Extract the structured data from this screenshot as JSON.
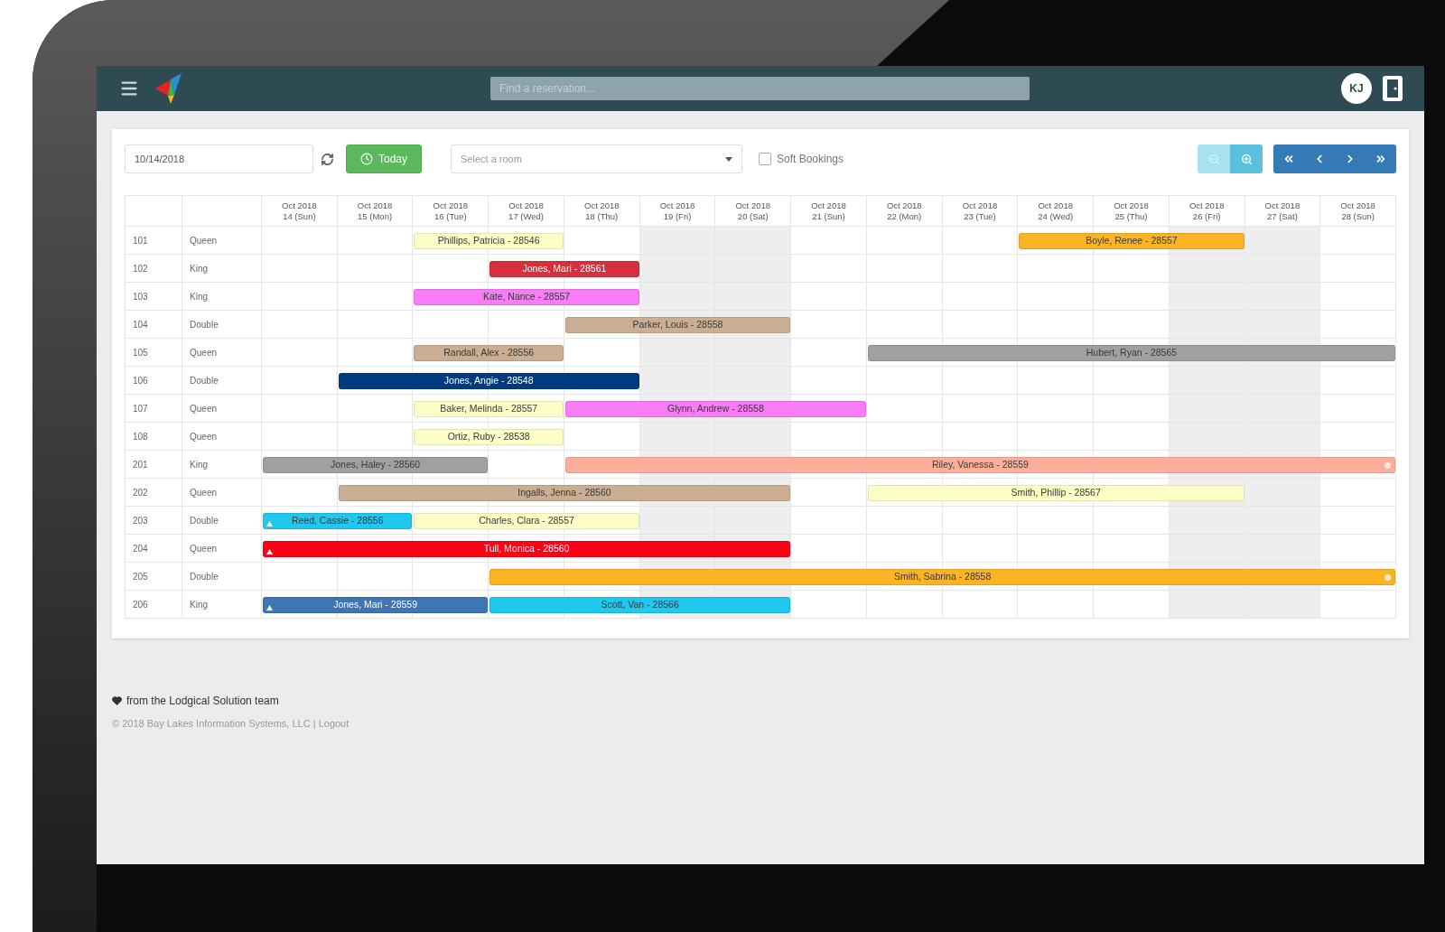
{
  "navbar": {
    "search": {
      "placeholder": "Find a reservation..."
    },
    "user": {
      "initials": "KJ"
    }
  },
  "toolbar": {
    "date": {
      "value": "10/14/2018"
    },
    "today_button": "Today",
    "room_select": {
      "placeholder": "Select a room"
    },
    "soft_bookings": {
      "label": "Soft Bookings",
      "checked": false
    },
    "zoom_buttons": [
      {
        "kind": "zoom_out",
        "disabled": true
      },
      {
        "kind": "zoom_in",
        "disabled": false
      }
    ]
  },
  "calendar": {
    "columns": [
      {
        "month": "Oct 2018",
        "day": "14 (Sun)",
        "shaded": false
      },
      {
        "month": "Oct 2018",
        "day": "15 (Mon)",
        "shaded": false
      },
      {
        "month": "Oct 2018",
        "day": "16 (Tue)",
        "shaded": false
      },
      {
        "month": "Oct 2018",
        "day": "17 (Wed)",
        "shaded": false
      },
      {
        "month": "Oct 2018",
        "day": "18 (Thu)",
        "shaded": false
      },
      {
        "month": "Oct 2018",
        "day": "19 (Fri)",
        "shaded": true
      },
      {
        "month": "Oct 2018",
        "day": "20 (Sat)",
        "shaded": true
      },
      {
        "month": "Oct 2018",
        "day": "21 (Sun)",
        "shaded": false
      },
      {
        "month": "Oct 2018",
        "day": "22 (Mon)",
        "shaded": false
      },
      {
        "month": "Oct 2018",
        "day": "23 (Tue)",
        "shaded": false
      },
      {
        "month": "Oct 2018",
        "day": "24 (Wed)",
        "shaded": false
      },
      {
        "month": "Oct 2018",
        "day": "25 (Thu)",
        "shaded": false
      },
      {
        "month": "Oct 2018",
        "day": "26 (Fri)",
        "shaded": true
      },
      {
        "month": "Oct 2018",
        "day": "27 (Sat)",
        "shaded": true
      },
      {
        "month": "Oct 2018",
        "day": "28 (Sun)",
        "shaded": false
      }
    ],
    "rows": [
      {
        "room": "101",
        "type": "Queen",
        "days": [
          {
            "kind": "vacant"
          },
          {
            "kind": "vacant"
          },
          {
            "kind": "check_in",
            "label": "Phillips, Patricia - 28546",
            "color": "#fdfdc6",
            "marker_start": false,
            "marker_end": false
          },
          {
            "kind": "stay"
          },
          {
            "kind": "vacant"
          },
          {
            "kind": "vacant"
          },
          {
            "kind": "vacant"
          },
          {
            "kind": "vacant"
          },
          {
            "kind": "vacant"
          },
          {
            "kind": "vacant"
          },
          {
            "kind": "check_in",
            "label": "Boyle, Renee - 28557",
            "color": "#fbb424",
            "marker_start": false,
            "marker_end": false
          },
          {
            "kind": "stay"
          },
          {
            "kind": "stay"
          },
          {
            "kind": "vacant"
          },
          {
            "kind": "vacant"
          }
        ]
      },
      {
        "room": "102",
        "type": "King",
        "days": [
          {
            "kind": "vacant"
          },
          {
            "kind": "vacant"
          },
          {
            "kind": "vacant"
          },
          {
            "kind": "check_in",
            "label": "Jones, Mari - 28561",
            "color": "#d7303c",
            "marker_start": false,
            "marker_end": false
          },
          {
            "kind": "stay"
          },
          {
            "kind": "vacant"
          },
          {
            "kind": "vacant"
          },
          {
            "kind": "vacant"
          },
          {
            "kind": "vacant"
          },
          {
            "kind": "vacant"
          },
          {
            "kind": "vacant"
          },
          {
            "kind": "vacant"
          },
          {
            "kind": "vacant"
          },
          {
            "kind": "vacant"
          },
          {
            "kind": "vacant"
          }
        ]
      },
      {
        "room": "103",
        "type": "King",
        "days": [
          {
            "kind": "vacant"
          },
          {
            "kind": "vacant"
          },
          {
            "kind": "check_in",
            "label": "Kate, Nance - 28557",
            "color": "#f77cf5",
            "marker_start": false,
            "marker_end": false
          },
          {
            "kind": "stay"
          },
          {
            "kind": "stay"
          },
          {
            "kind": "vacant"
          },
          {
            "kind": "vacant"
          },
          {
            "kind": "vacant"
          },
          {
            "kind": "vacant"
          },
          {
            "kind": "vacant"
          },
          {
            "kind": "vacant"
          },
          {
            "kind": "vacant"
          },
          {
            "kind": "vacant"
          },
          {
            "kind": "vacant"
          },
          {
            "kind": "vacant"
          }
        ]
      },
      {
        "room": "104",
        "type": "Double",
        "days": [
          {
            "kind": "vacant"
          },
          {
            "kind": "vacant"
          },
          {
            "kind": "vacant"
          },
          {
            "kind": "vacant"
          },
          {
            "kind": "check_in",
            "label": "Parker, Louis - 28558",
            "color": "#c9ae93",
            "marker_start": false,
            "marker_end": false
          },
          {
            "kind": "stay"
          },
          {
            "kind": "stay"
          },
          {
            "kind": "vacant"
          },
          {
            "kind": "vacant"
          },
          {
            "kind": "vacant"
          },
          {
            "kind": "vacant"
          },
          {
            "kind": "vacant"
          },
          {
            "kind": "vacant"
          },
          {
            "kind": "vacant"
          },
          {
            "kind": "vacant"
          }
        ]
      },
      {
        "room": "105",
        "type": "Queen",
        "days": [
          {
            "kind": "vacant"
          },
          {
            "kind": "vacant"
          },
          {
            "kind": "check_in",
            "label": "Randall, Alex - 28556",
            "color": "#c9ae93",
            "marker_start": false,
            "marker_end": false
          },
          {
            "kind": "stay"
          },
          {
            "kind": "vacant"
          },
          {
            "kind": "vacant"
          },
          {
            "kind": "vacant"
          },
          {
            "kind": "vacant"
          },
          {
            "kind": "check_in",
            "label": "Hubert, Ryan - 28565",
            "color": "#9fa0a2",
            "marker_start": false,
            "marker_end": false
          },
          {
            "kind": "stay"
          },
          {
            "kind": "stay"
          },
          {
            "kind": "stay"
          },
          {
            "kind": "stay"
          },
          {
            "kind": "stay"
          },
          {
            "kind": "stay"
          }
        ]
      },
      {
        "room": "106",
        "type": "Double",
        "days": [
          {
            "kind": "vacant"
          },
          {
            "kind": "check_in",
            "label": "Jones, Angie - 28548",
            "color": "#003b7f",
            "marker_start": false,
            "marker_end": false
          },
          {
            "kind": "stay"
          },
          {
            "kind": "stay"
          },
          {
            "kind": "stay"
          },
          {
            "kind": "vacant"
          },
          {
            "kind": "vacant"
          },
          {
            "kind": "vacant"
          },
          {
            "kind": "vacant"
          },
          {
            "kind": "vacant"
          },
          {
            "kind": "vacant"
          },
          {
            "kind": "vacant"
          },
          {
            "kind": "vacant"
          },
          {
            "kind": "vacant"
          },
          {
            "kind": "vacant"
          }
        ]
      },
      {
        "room": "107",
        "type": "Queen",
        "days": [
          {
            "kind": "vacant"
          },
          {
            "kind": "vacant"
          },
          {
            "kind": "check_in",
            "label": "Baker, Melinda - 28557",
            "color": "#fdfdc6",
            "marker_start": false,
            "marker_end": false
          },
          {
            "kind": "stay"
          },
          {
            "kind": "check_in",
            "label": "Glynn, Andrew - 28558",
            "color": "#f77cf5",
            "marker_start": false,
            "marker_end": false
          },
          {
            "kind": "stay"
          },
          {
            "kind": "stay"
          },
          {
            "kind": "stay"
          },
          {
            "kind": "vacant"
          },
          {
            "kind": "vacant"
          },
          {
            "kind": "vacant"
          },
          {
            "kind": "vacant"
          },
          {
            "kind": "vacant"
          },
          {
            "kind": "vacant"
          },
          {
            "kind": "vacant"
          }
        ]
      },
      {
        "room": "108",
        "type": "Queen",
        "days": [
          {
            "kind": "vacant"
          },
          {
            "kind": "vacant"
          },
          {
            "kind": "check_in",
            "label": "Ortiz, Ruby - 28538",
            "color": "#fdfdc6",
            "marker_start": false,
            "marker_end": false
          },
          {
            "kind": "stay"
          },
          {
            "kind": "vacant"
          },
          {
            "kind": "vacant"
          },
          {
            "kind": "vacant"
          },
          {
            "kind": "vacant"
          },
          {
            "kind": "vacant"
          },
          {
            "kind": "vacant"
          },
          {
            "kind": "vacant"
          },
          {
            "kind": "vacant"
          },
          {
            "kind": "vacant"
          },
          {
            "kind": "vacant"
          },
          {
            "kind": "vacant"
          }
        ]
      },
      {
        "room": "201",
        "type": "King",
        "days": [
          {
            "kind": "check_in",
            "label": "Jones, Haley - 28560",
            "color": "#9fa0a2",
            "marker_start": false,
            "marker_end": false
          },
          {
            "kind": "stay"
          },
          {
            "kind": "stay"
          },
          {
            "kind": "vacant"
          },
          {
            "kind": "check_in",
            "label": "Riley, Vanessa - 28559",
            "color": "#fcae9b",
            "marker_start": false,
            "marker_end": true
          },
          {
            "kind": "stay"
          },
          {
            "kind": "stay"
          },
          {
            "kind": "stay"
          },
          {
            "kind": "stay"
          },
          {
            "kind": "stay"
          },
          {
            "kind": "stay"
          },
          {
            "kind": "stay"
          },
          {
            "kind": "stay"
          },
          {
            "kind": "stay"
          },
          {
            "kind": "stay"
          }
        ]
      },
      {
        "room": "202",
        "type": "Queen",
        "days": [
          {
            "kind": "vacant"
          },
          {
            "kind": "check_in",
            "label": "Ingalls, Jenna - 28560",
            "color": "#c9ae93",
            "marker_start": false,
            "marker_end": false
          },
          {
            "kind": "stay"
          },
          {
            "kind": "stay"
          },
          {
            "kind": "stay"
          },
          {
            "kind": "stay"
          },
          {
            "kind": "stay"
          },
          {
            "kind": "vacant"
          },
          {
            "kind": "check_in",
            "label": "Smith, Phillip - 28567",
            "color": "#fdfdc6",
            "marker_start": false,
            "marker_end": false
          },
          {
            "kind": "stay"
          },
          {
            "kind": "stay"
          },
          {
            "kind": "stay"
          },
          {
            "kind": "stay"
          },
          {
            "kind": "vacant"
          },
          {
            "kind": "vacant"
          }
        ]
      },
      {
        "room": "203",
        "type": "Double",
        "days": [
          {
            "kind": "check_in",
            "label": "Reed, Cassie - 28556",
            "color": "#1ec8ef",
            "marker_start": true,
            "marker_end": false
          },
          {
            "kind": "stay"
          },
          {
            "kind": "check_in",
            "label": "Charles, Clara - 28557",
            "color": "#fdfdc6",
            "marker_start": false,
            "marker_end": false
          },
          {
            "kind": "stay"
          },
          {
            "kind": "stay"
          },
          {
            "kind": "vacant"
          },
          {
            "kind": "vacant"
          },
          {
            "kind": "vacant"
          },
          {
            "kind": "vacant"
          },
          {
            "kind": "vacant"
          },
          {
            "kind": "vacant"
          },
          {
            "kind": "vacant"
          },
          {
            "kind": "vacant"
          },
          {
            "kind": "vacant"
          },
          {
            "kind": "vacant"
          }
        ]
      },
      {
        "room": "204",
        "type": "Queen",
        "days": [
          {
            "kind": "check_in",
            "label": "Tull, Monica - 28560",
            "color": "#ff0016",
            "marker_start": true,
            "marker_end": false
          },
          {
            "kind": "stay"
          },
          {
            "kind": "stay"
          },
          {
            "kind": "stay"
          },
          {
            "kind": "stay"
          },
          {
            "kind": "stay"
          },
          {
            "kind": "stay"
          },
          {
            "kind": "vacant"
          },
          {
            "kind": "vacant"
          },
          {
            "kind": "vacant"
          },
          {
            "kind": "vacant"
          },
          {
            "kind": "vacant"
          },
          {
            "kind": "vacant"
          },
          {
            "kind": "vacant"
          },
          {
            "kind": "vacant"
          }
        ]
      },
      {
        "room": "205",
        "type": "Double",
        "days": [
          {
            "kind": "vacant"
          },
          {
            "kind": "vacant"
          },
          {
            "kind": "vacant"
          },
          {
            "kind": "check_in",
            "label": "Smith, Sabrina - 28558",
            "color": "#fbb424",
            "marker_start": false,
            "marker_end": true
          },
          {
            "kind": "stay"
          },
          {
            "kind": "stay"
          },
          {
            "kind": "stay"
          },
          {
            "kind": "stay"
          },
          {
            "kind": "stay"
          },
          {
            "kind": "stay"
          },
          {
            "kind": "stay"
          },
          {
            "kind": "stay"
          },
          {
            "kind": "stay"
          },
          {
            "kind": "stay"
          },
          {
            "kind": "stay"
          }
        ]
      },
      {
        "room": "206",
        "type": "King",
        "days": [
          {
            "kind": "check_in",
            "label": "Jones, Mari - 28559",
            "color": "#3f74b5",
            "marker_start": true,
            "marker_end": false
          },
          {
            "kind": "stay"
          },
          {
            "kind": "stay"
          },
          {
            "kind": "check_in",
            "label": "Scott, Van - 28566",
            "color": "#1ec8ef",
            "marker_start": false,
            "marker_end": false
          },
          {
            "kind": "stay"
          },
          {
            "kind": "stay"
          },
          {
            "kind": "stay"
          },
          {
            "kind": "vacant"
          },
          {
            "kind": "vacant"
          },
          {
            "kind": "vacant"
          },
          {
            "kind": "vacant"
          },
          {
            "kind": "vacant"
          },
          {
            "kind": "vacant"
          },
          {
            "kind": "vacant"
          },
          {
            "kind": "vacant"
          }
        ]
      }
    ]
  },
  "footer": {
    "tagline": "from the Lodgical Solution team",
    "copyright": "© 2018 Bay Lakes Information Systems, LLC |",
    "logout_link": "Logout"
  }
}
